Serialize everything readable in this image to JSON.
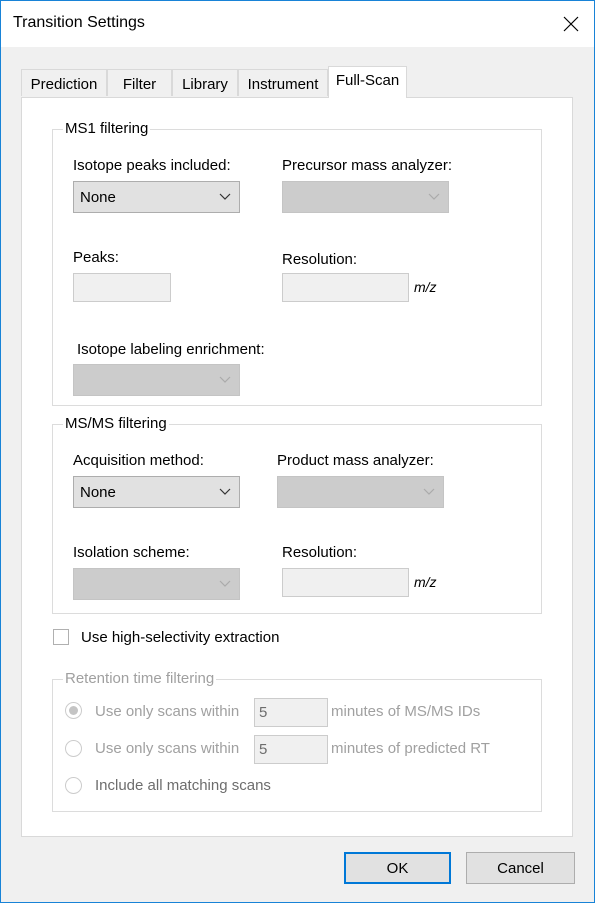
{
  "window": {
    "title": "Transition Settings",
    "close_icon": "close-icon"
  },
  "tabs": [
    {
      "label": "Prediction",
      "active": false
    },
    {
      "label": "Filter",
      "active": false
    },
    {
      "label": "Library",
      "active": false
    },
    {
      "label": "Instrument",
      "active": false
    },
    {
      "label": "Full-Scan",
      "active": true
    }
  ],
  "ms1": {
    "title": "MS1 filtering",
    "isotope_peaks_label": "Isotope peaks included:",
    "isotope_peaks_value": "None",
    "precursor_analyzer_label": "Precursor mass analyzer:",
    "precursor_analyzer_value": "",
    "peaks_label": "Peaks:",
    "peaks_value": "",
    "resolution_label": "Resolution:",
    "resolution_value": "",
    "resolution_unit": "m/z",
    "enrichment_label": "Isotope labeling enrichment:",
    "enrichment_value": ""
  },
  "msms": {
    "title": "MS/MS filtering",
    "acquisition_label": "Acquisition method:",
    "acquisition_value": "None",
    "product_analyzer_label": "Product mass analyzer:",
    "product_analyzer_value": "",
    "isolation_label": "Isolation scheme:",
    "isolation_value": "",
    "resolution_label": "Resolution:",
    "resolution_value": "",
    "resolution_unit": "m/z"
  },
  "high_selectivity": {
    "label": "Use high-selectivity extraction",
    "checked": false
  },
  "retention": {
    "title": "Retention time filtering",
    "options": [
      {
        "prefix": "Use only scans within",
        "value": "5",
        "suffix": "minutes of MS/MS IDs",
        "checked": true
      },
      {
        "prefix": "Use only scans within",
        "value": "5",
        "suffix": "minutes of predicted RT",
        "checked": false
      },
      {
        "prefix": "Include all matching scans",
        "checked": false
      }
    ]
  },
  "buttons": {
    "ok": "OK",
    "cancel": "Cancel"
  }
}
